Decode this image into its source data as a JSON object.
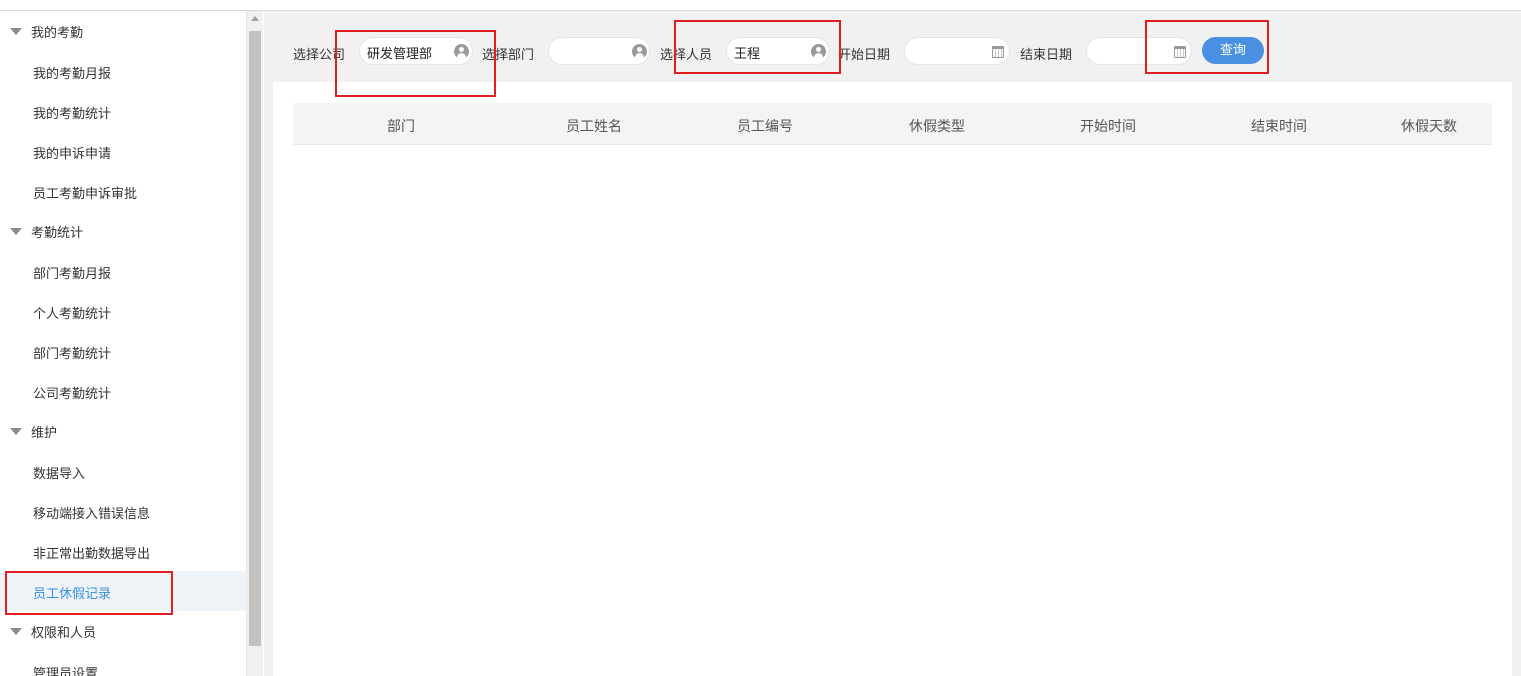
{
  "sidebar": {
    "groups": [
      {
        "label": "我的考勤",
        "items": [
          "我的考勤月报",
          "我的考勤统计",
          "我的申诉申请",
          "员工考勤申诉审批"
        ]
      },
      {
        "label": "考勤统计",
        "items": [
          "部门考勤月报",
          "个人考勤统计",
          "部门考勤统计",
          "公司考勤统计"
        ]
      },
      {
        "label": "维护",
        "items": [
          "数据导入",
          "移动端接入错误信息",
          "非正常出勤数据导出",
          "员工休假记录"
        ]
      },
      {
        "label": "权限和人员",
        "items": [
          "管理员设置"
        ]
      }
    ],
    "active_item": "员工休假记录"
  },
  "filters": {
    "company_label": "选择公司",
    "company_value": "研发管理部",
    "department_label": "选择部门",
    "department_value": "",
    "person_label": "选择人员",
    "person_value": "王程",
    "start_date_label": "开始日期",
    "start_date_value": "",
    "end_date_label": "结束日期",
    "end_date_value": "",
    "query_button": "查询"
  },
  "table": {
    "columns": [
      "部门",
      "员工姓名",
      "员工编号",
      "休假类型",
      "开始时间",
      "结束时间",
      "休假天数"
    ],
    "rows": []
  },
  "colors": {
    "accent": "#4a90e2",
    "highlight_box": "#e02020",
    "active_item_bg": "#eef3f8"
  }
}
